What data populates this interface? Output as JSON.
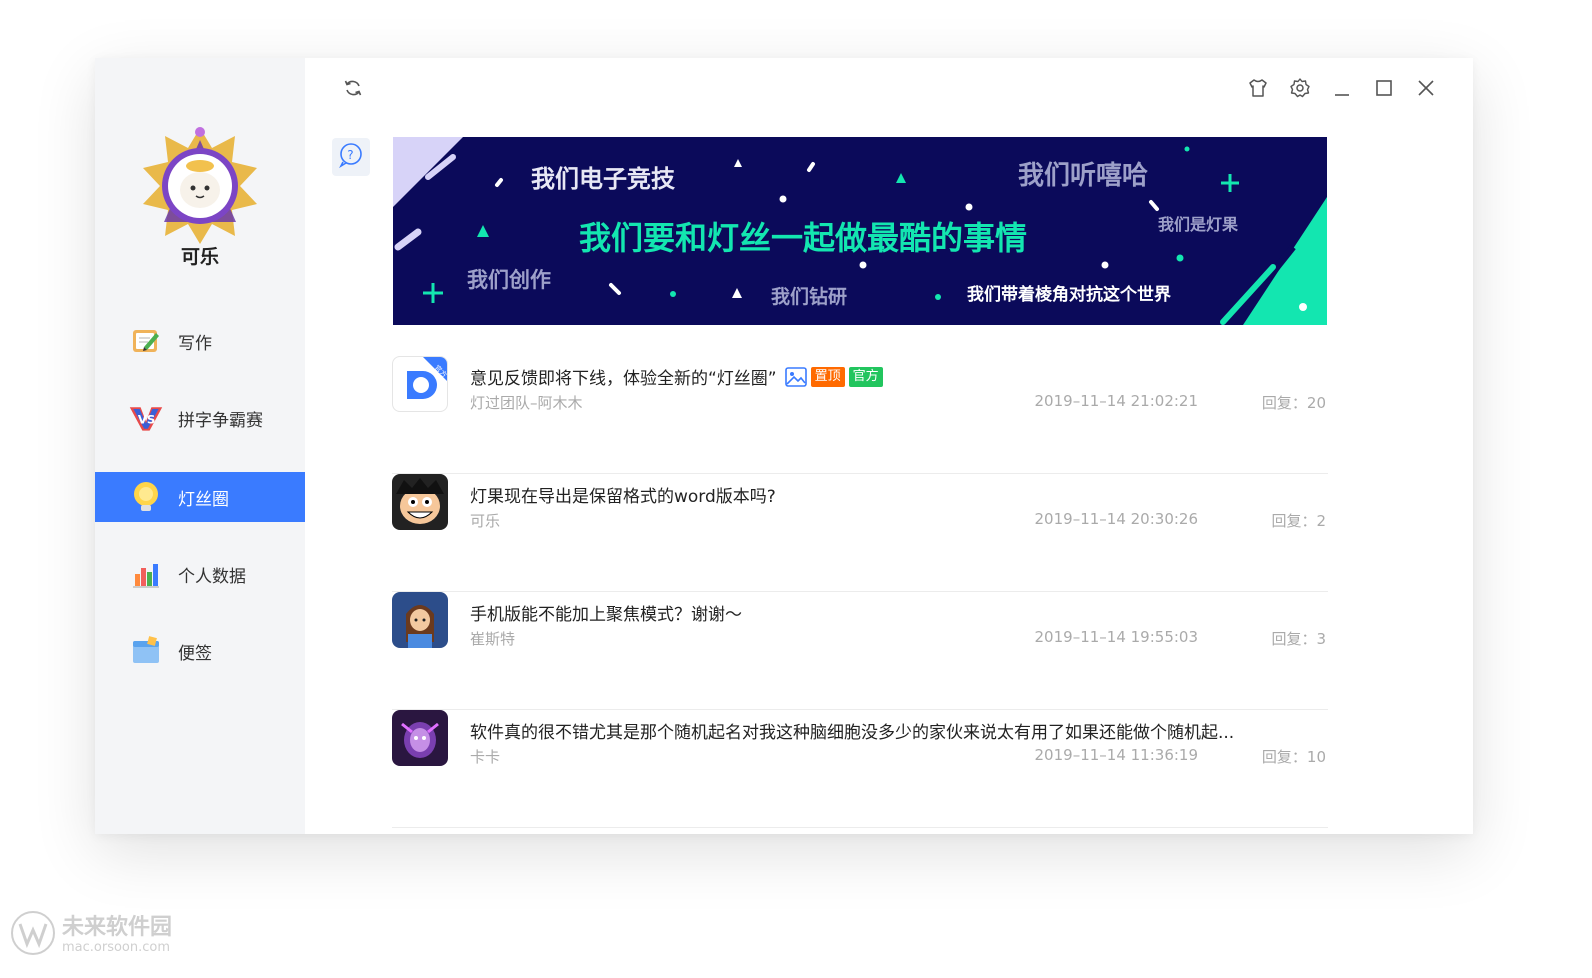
{
  "user": {
    "name": "可乐"
  },
  "sidebar": {
    "items": [
      {
        "label": "写作",
        "icon": "writing-icon"
      },
      {
        "label": "拼字争霸赛",
        "icon": "vs-icon"
      },
      {
        "label": "灯丝圈",
        "icon": "bulb-icon",
        "active": true
      },
      {
        "label": "个人数据",
        "icon": "stats-icon"
      },
      {
        "label": "便签",
        "icon": "note-icon"
      }
    ]
  },
  "banner": {
    "headline": "我们要和灯丝一起做最酷的事情",
    "phrases": [
      "我们电子竞技",
      "我们听嘻哈",
      "我们是灯果",
      "我们创作",
      "我们钻研",
      "我们带着棱角对抗这个世界"
    ]
  },
  "posts": [
    {
      "title": "意见反馈即将下线，体验全新的“灯丝圈”",
      "author": "灯过团队–阿木木",
      "date": "2019–11–14 21:02:21",
      "reply": "回复：20",
      "tags": [
        "置顶",
        "官方"
      ],
      "avatar_badge": "官方"
    },
    {
      "title": "灯果现在导出是保留格式的word版本吗?",
      "author": "可乐",
      "date": "2019–11–14 20:30:26",
      "reply": "回复：2"
    },
    {
      "title": "手机版能不能加上聚焦模式？谢谢～",
      "author": "崔斯特",
      "date": "2019–11–14 19:55:03",
      "reply": "回复：3"
    },
    {
      "title": "软件真的很不错尤其是那个随机起名对我这种脑细胞没多少的家伙来说太有用了如果还能做个随机起...",
      "author": "卡卡",
      "date": "2019–11–14 11:36:19",
      "reply": "回复：10"
    }
  ],
  "watermark": {
    "line1": "未来软件园",
    "line2": "mac.orsoon.com"
  },
  "colors": {
    "accent": "#3a7bff",
    "banner_bg": "#0b0a5a",
    "banner_green": "#13e6b0",
    "tag_top": "#ff6a00",
    "tag_official": "#22c55e"
  }
}
